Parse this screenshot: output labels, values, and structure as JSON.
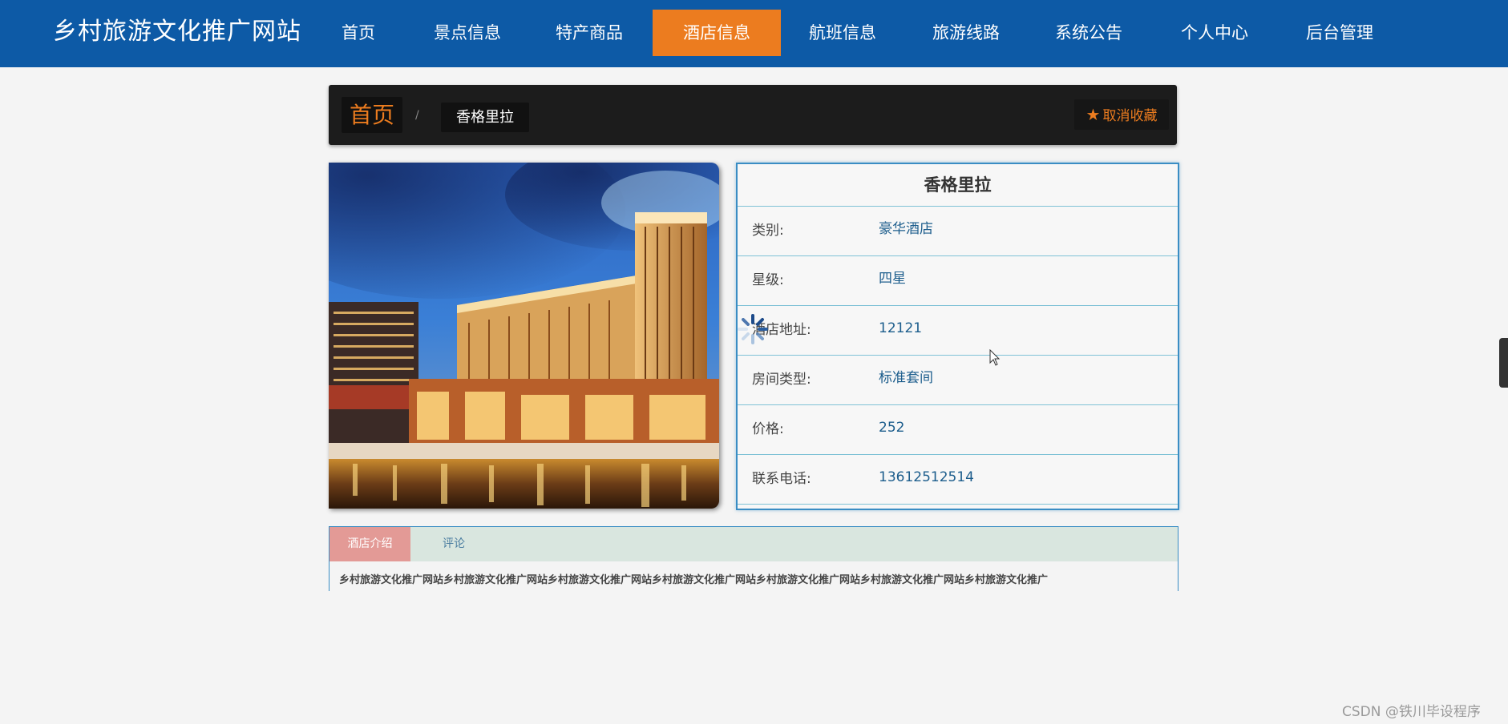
{
  "brand": "乡村旅游文化推广网站",
  "nav": [
    {
      "label": "首页",
      "active": false
    },
    {
      "label": "景点信息",
      "active": false
    },
    {
      "label": "特产商品",
      "active": false
    },
    {
      "label": "酒店信息",
      "active": true
    },
    {
      "label": "航班信息",
      "active": false
    },
    {
      "label": "旅游线路",
      "active": false
    },
    {
      "label": "系统公告",
      "active": false
    },
    {
      "label": "个人中心",
      "active": false
    },
    {
      "label": "后台管理",
      "active": false
    }
  ],
  "breadcrumb": {
    "home": "首页",
    "separator": "/",
    "current": "香格里拉",
    "favorite_label": "取消收藏",
    "favorite_icon": "star-icon"
  },
  "hotel": {
    "name": "香格里拉",
    "fields": [
      {
        "label": "类别:",
        "value": "豪华酒店"
      },
      {
        "label": "星级:",
        "value": "四星"
      },
      {
        "label": "酒店地址:",
        "value": "12121"
      },
      {
        "label": "房间类型:",
        "value": "标准套间"
      },
      {
        "label": "价格:",
        "value": "252"
      },
      {
        "label": "联系电话:",
        "value": "13612512514"
      }
    ]
  },
  "tabs": [
    {
      "label": "酒店介绍",
      "active": true
    },
    {
      "label": "评论",
      "active": false
    }
  ],
  "intro_text": "乡村旅游文化推广网站乡村旅游文化推广网站乡村旅游文化推广网站乡村旅游文化推广网站乡村旅游文化推广网站乡村旅游文化推广网站乡村旅游文化推广",
  "watermark": "CSDN @铁川毕设程序",
  "colors": {
    "nav_bg": "#0d5aa6",
    "accent": "#ec7c1f",
    "panel_border": "#3a8dc4",
    "tab_active": "#e39a96"
  }
}
